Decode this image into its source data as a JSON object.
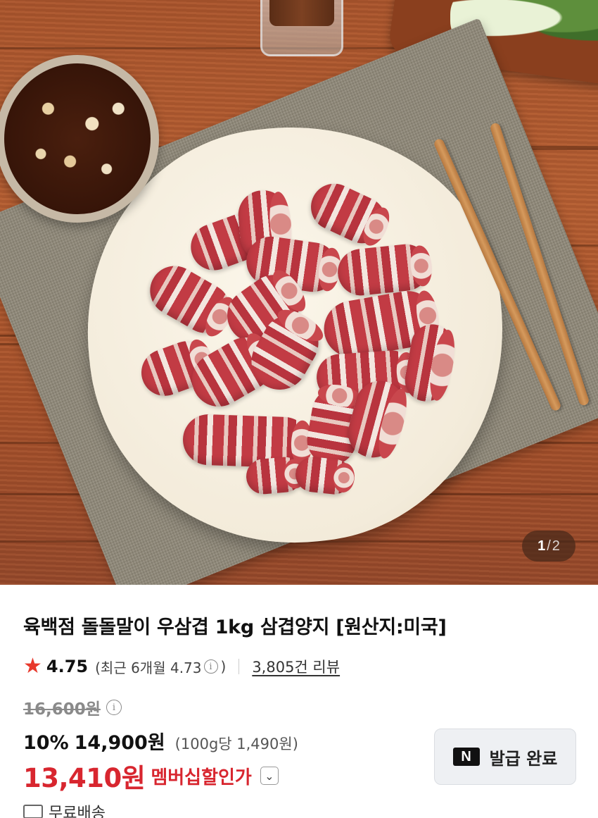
{
  "gallery": {
    "current": "1",
    "separator": "/",
    "total": "2"
  },
  "product": {
    "title": "육백점 돌돌말이 우삼겹 1kg 삼겹양지 [원산지:미국]",
    "rating": "4.75",
    "recent_rating_prefix": "(최근 6개월 4.73",
    "recent_rating_suffix": ")",
    "info_icon_glyph": "i",
    "review_count": "3,805건 리뷰",
    "original_price": "16,600원",
    "discount_rate": "10%",
    "sale_price": "14,900원",
    "unit_price": "(100g당 1,490원)",
    "member_price": "13,410원",
    "member_label": "멤버십할인가",
    "shipping": "무료배송"
  },
  "coupon": {
    "badge": "N",
    "label": "발급 완료"
  },
  "icons": [
    "star-icon",
    "info-icon",
    "chevron-down-icon",
    "naver-n-icon",
    "truck-icon"
  ],
  "colors": {
    "star": "#e8392c",
    "member_price": "#d8262f",
    "coupon_bg": "#eef0f3"
  }
}
